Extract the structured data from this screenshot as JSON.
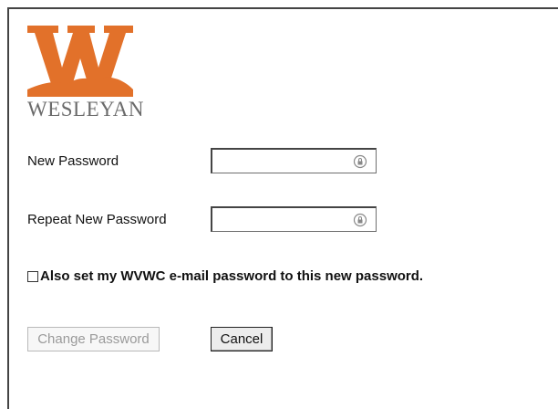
{
  "brand": {
    "name": "WESLEYAN",
    "colors": {
      "orange": "#e2712a",
      "gray": "#6b6b6b"
    }
  },
  "form": {
    "new_password_label": "New Password",
    "repeat_password_label": "Repeat New Password",
    "new_password_value": "",
    "repeat_password_value": "",
    "password_icon": "password-reveal-icon",
    "checkbox_label": "Also set my WVWC e-mail password to this new password.",
    "checkbox_checked": false,
    "change_button_label": "Change Password",
    "change_button_disabled": true,
    "cancel_button_label": "Cancel"
  }
}
